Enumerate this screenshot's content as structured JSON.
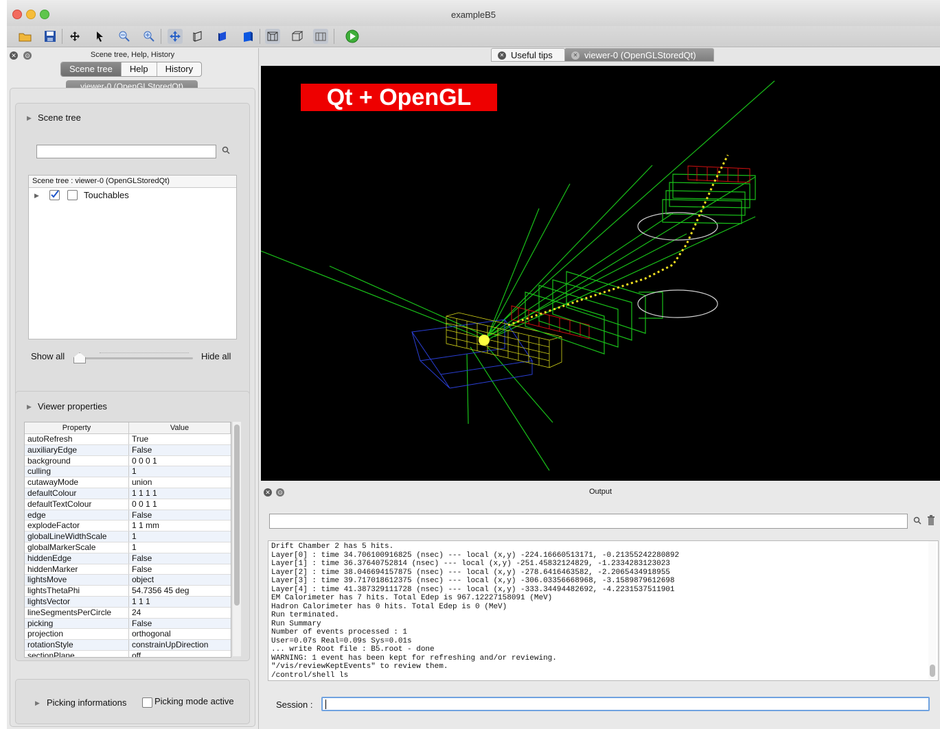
{
  "window": {
    "title": "exampleB5"
  },
  "toolbar": {
    "icons": [
      "open-icon",
      "save-icon",
      "move-icon",
      "pick-icon",
      "zoom-out-icon",
      "zoom-in-icon",
      "rotate-icon",
      "wireframe-icon",
      "surface-icon",
      "solid-icon",
      "perspective-icon",
      "ortho-icon",
      "hidden-line-icon",
      "run-icon"
    ]
  },
  "left_dock": {
    "title": "Scene tree, Help, History",
    "tabs": [
      "Scene tree",
      "Help",
      "History"
    ],
    "selected_tab": "Scene tree",
    "viewer_chip": "viewer-0 (OpenGLStoredQt)",
    "scene_tree": {
      "label": "Scene tree",
      "search_value": "",
      "tree_header": "Scene tree : viewer-0 (OpenGLStoredQt)",
      "items": [
        {
          "label": "Touchables",
          "checked": true
        }
      ],
      "show_all": "Show all",
      "hide_all": "Hide all"
    },
    "viewer_properties": {
      "label": "Viewer properties",
      "headers": [
        "Property",
        "Value"
      ],
      "rows": [
        [
          "autoRefresh",
          "True"
        ],
        [
          "auxiliaryEdge",
          "False"
        ],
        [
          "background",
          "0  0  0  1"
        ],
        [
          "culling",
          "1"
        ],
        [
          "cutawayMode",
          "union"
        ],
        [
          "defaultColour",
          "1  1  1  1"
        ],
        [
          "defaultTextColour",
          "0  0  1  1"
        ],
        [
          "edge",
          "False"
        ],
        [
          "explodeFactor",
          "1  1 mm"
        ],
        [
          "globalLineWidthScale",
          "1"
        ],
        [
          "globalMarkerScale",
          "1"
        ],
        [
          "hiddenEdge",
          "False"
        ],
        [
          "hiddenMarker",
          "False"
        ],
        [
          "lightsMove",
          "object"
        ],
        [
          "lightsThetaPhi",
          "54.7356  45  deg"
        ],
        [
          "lightsVector",
          "1  1  1"
        ],
        [
          "lineSegmentsPerCircle",
          "24"
        ],
        [
          "picking",
          "False"
        ],
        [
          "projection",
          "orthogonal"
        ],
        [
          "rotationStyle",
          "constrainUpDirection"
        ],
        [
          "sectionPlane",
          "off"
        ]
      ]
    },
    "picking": {
      "label": "Picking informations",
      "checkbox_label": "Picking mode active"
    }
  },
  "tabs": [
    {
      "label": "Useful tips",
      "active": false
    },
    {
      "label": "viewer-0 (OpenGLStoredQt)",
      "active": true
    }
  ],
  "viewer": {
    "overlay_label": "Qt + OpenGL",
    "background": "#000000"
  },
  "output": {
    "title": "Output",
    "search_value": "",
    "lines": [
      "Drift Chamber 2 has 5 hits.",
      "Layer[0] : time 34.706100916825 (nsec) --- local (x,y) -224.16660513171, -0.21355242280892",
      "Layer[1] : time 36.37640752814 (nsec) --- local (x,y) -251.45832124829, -1.2334283123023",
      "Layer[2] : time 38.046694157875 (nsec) --- local (x,y) -278.6416463582, -2.2065434918955",
      "Layer[3] : time 39.717018612375 (nsec) --- local (x,y) -306.03356668968, -3.1589879612698",
      "Layer[4] : time 41.387329111728 (nsec) --- local (x,y) -333.34494482692, -4.2231537511901",
      "EM Calorimeter has 7 hits. Total Edep is 967.12227158091 (MeV)",
      "Hadron Calorimeter has 0 hits. Total Edep is 0 (MeV)",
      "Run terminated.",
      "Run Summary",
      "Number of events processed : 1",
      "User=0.07s Real=0.09s Sys=0.01s",
      "... write Root file : B5.root - done",
      "WARNING: 1 event has been kept for refreshing and/or reviewing.",
      "\"/vis/reviewKeptEvents\" to review them.",
      "/control/shell ls"
    ],
    "session_label": "Session :",
    "session_value": ""
  }
}
